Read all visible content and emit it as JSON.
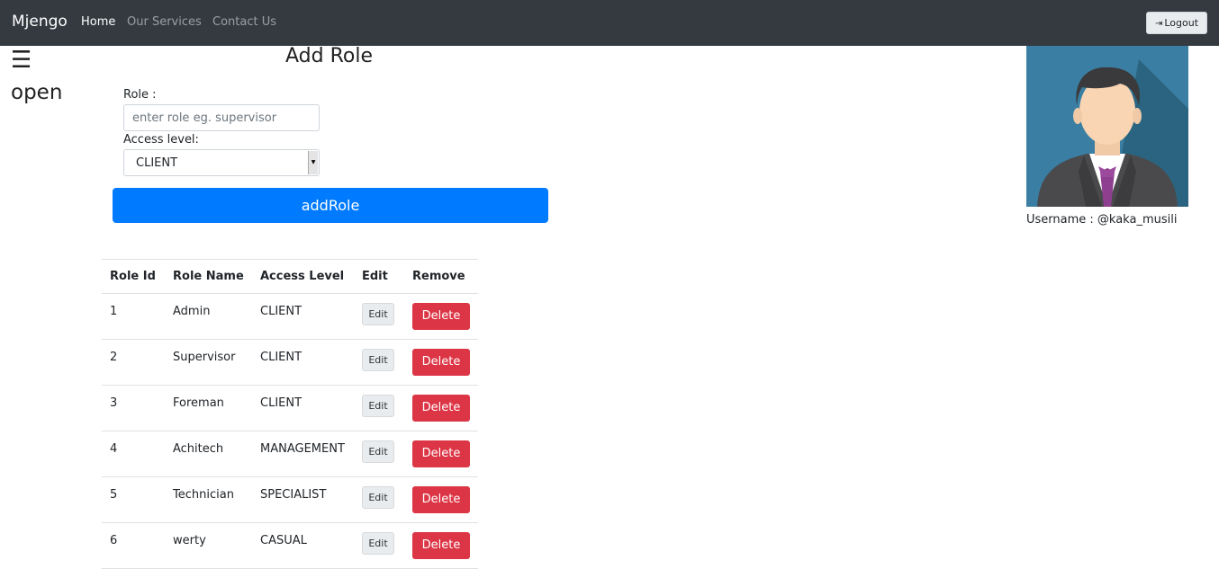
{
  "navbar": {
    "brand": "Mjengo",
    "links": [
      "Home",
      "Our Services",
      "Contact Us"
    ],
    "logout_label": "Logout",
    "logout_icon": "sign-out-icon"
  },
  "sidebar": {
    "menu_icon": "☰",
    "open_label": "open"
  },
  "form": {
    "title": "Add Role",
    "role_label": "Role :",
    "role_placeholder": "enter role eg. supervisor",
    "access_label": "Access level:",
    "access_selected": "CLIENT",
    "submit_label": "addRole"
  },
  "profile": {
    "username_label": "Username : @kaka_musili"
  },
  "table": {
    "headers": [
      "Role Id",
      "Role Name",
      "Access Level",
      "Edit",
      "Remove"
    ],
    "rows": [
      {
        "id": "1",
        "name": "Admin",
        "access": "CLIENT",
        "edit": "Edit",
        "remove": "Delete"
      },
      {
        "id": "2",
        "name": "Supervisor",
        "access": "CLIENT",
        "edit": "Edit",
        "remove": "Delete"
      },
      {
        "id": "3",
        "name": "Foreman",
        "access": "CLIENT",
        "edit": "Edit",
        "remove": "Delete"
      },
      {
        "id": "4",
        "name": "Achitech",
        "access": "MANAGEMENT",
        "edit": "Edit",
        "remove": "Delete"
      },
      {
        "id": "5",
        "name": "Technician",
        "access": "SPECIALIST",
        "edit": "Edit",
        "remove": "Delete"
      },
      {
        "id": "6",
        "name": "werty",
        "access": "CASUAL",
        "edit": "Edit",
        "remove": "Delete"
      }
    ]
  },
  "colors": {
    "navbar": "#343a40",
    "primary": "#007bff",
    "danger": "#dc3545"
  }
}
